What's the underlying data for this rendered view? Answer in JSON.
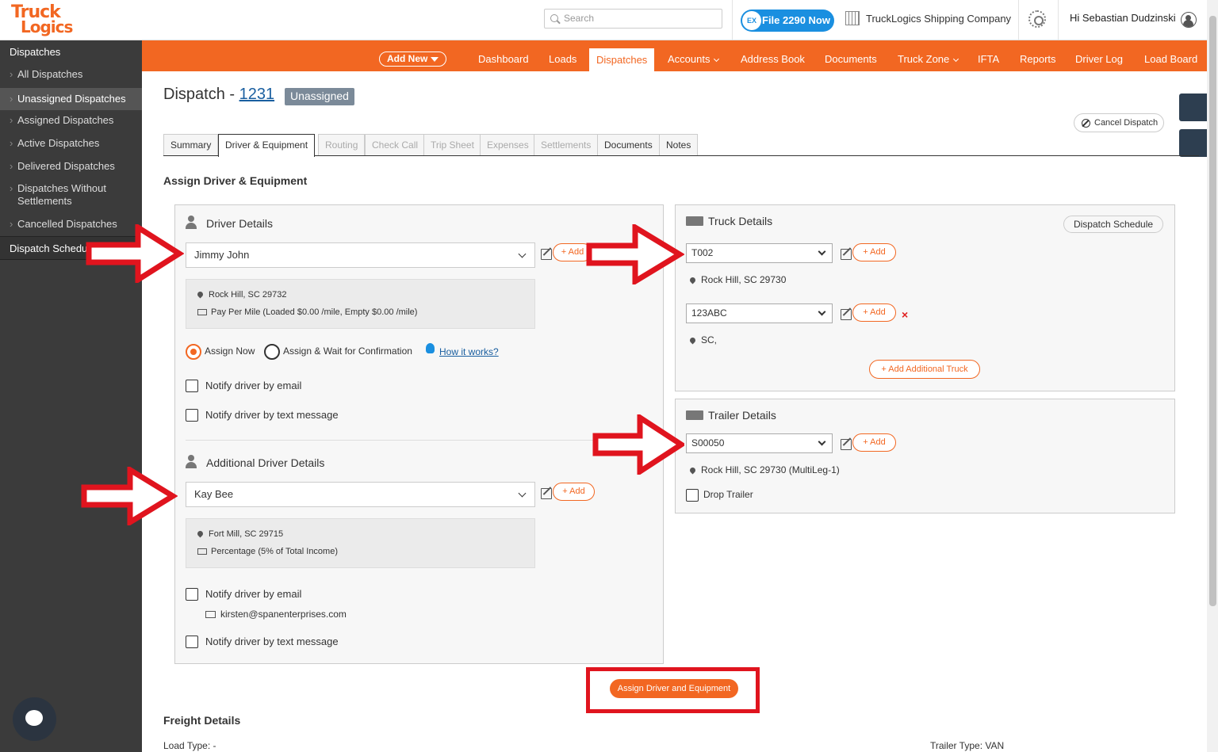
{
  "header": {
    "logo_line1": "Truck",
    "logo_line2": "Logics",
    "search_placeholder": "Search",
    "file2290_badge": "EX",
    "file2290_label": "File 2290 Now",
    "company": "TruckLogics Shipping Company",
    "greeting": "Hi Sebastian Dudzinski"
  },
  "sidebar": {
    "section": "Dispatches",
    "items": [
      {
        "label": "All Dispatches"
      },
      {
        "label": "Unassigned Dispatches"
      },
      {
        "label": "Assigned Dispatches"
      },
      {
        "label": "Active Dispatches"
      },
      {
        "label": "Delivered Dispatches"
      },
      {
        "label": "Dispatches Without Settlements"
      },
      {
        "label": "Cancelled Dispatches"
      }
    ],
    "footer": "Dispatch Schedule"
  },
  "nav": {
    "add_new": "Add New",
    "items": [
      "Dashboard",
      "Loads",
      "Dispatches",
      "Accounts",
      "Address Book",
      "Documents",
      "Truck Zone",
      "IFTA",
      "Reports",
      "Driver Log",
      "Load Board"
    ]
  },
  "page": {
    "title_prefix": "Dispatch -",
    "dispatch_number": "1231",
    "status": "Unassigned",
    "cancel_label": "Cancel Dispatch",
    "tabs": [
      "Summary",
      "Driver & Equipment",
      "Routing",
      "Check Call",
      "Trip Sheet",
      "Expenses",
      "Settlements",
      "Documents",
      "Notes"
    ],
    "section_title": "Assign Driver & Equipment"
  },
  "driver": {
    "title": "Driver Details",
    "selected": "Jimmy John",
    "add_label": "+ Add",
    "location": "Rock Hill, SC 29732",
    "pay": "Pay Per Mile (Loaded $0.00 /mile, Empty $0.00 /mile)",
    "assign_now": "Assign Now",
    "assign_wait": "Assign & Wait for Confirmation",
    "how_it_works": "How it works?",
    "notify_email": "Notify driver by email",
    "notify_text": "Notify driver by text message"
  },
  "additional_driver": {
    "title": "Additional Driver Details",
    "selected": "Kay Bee",
    "add_label": "+ Add",
    "location": "Fort Mill, SC 29715",
    "pay": "Percentage (5% of Total Income)",
    "notify_email": "Notify driver by email",
    "email": "kirsten@spanenterprises.com",
    "notify_text": "Notify driver by text message"
  },
  "truck": {
    "title": "Truck Details",
    "dispatch_schedule": "Dispatch Schedule",
    "truck1": "T002",
    "truck1_location": "Rock Hill, SC 29730",
    "truck2": "123ABC",
    "truck2_location": "SC,",
    "add_label": "+ Add",
    "add_additional": "+ Add Additional Truck",
    "remove": "×"
  },
  "trailer": {
    "title": "Trailer Details",
    "selected": "S00050",
    "add_label": "+ Add",
    "location": "Rock Hill, SC 29730 (MultiLeg-1)",
    "drop_trailer": "Drop Trailer"
  },
  "footer": {
    "assign_button": "Assign Driver and Equipment",
    "freight_title": "Freight Details",
    "load_type": "Load Type: -",
    "trailer_type": "Trailer Type: VAN"
  },
  "colors": {
    "brand_orange": "#f26722",
    "sidebar_bg": "#3b3b3b",
    "annotation_red": "#e0141e"
  }
}
